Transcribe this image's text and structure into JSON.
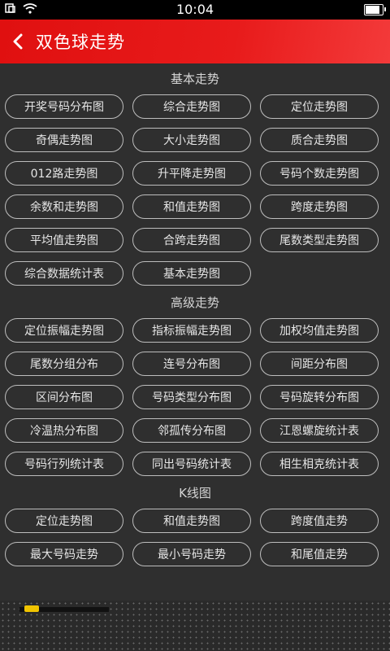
{
  "status": {
    "time": "10:04",
    "battery_level": 0.95
  },
  "header": {
    "title": "双色球走势",
    "back_icon": "chevron-left-icon"
  },
  "sections": [
    {
      "title": "基本走势",
      "items": [
        "开奖号码分布图",
        "综合走势图",
        "定位走势图",
        "奇偶走势图",
        "大小走势图",
        "质合走势图",
        "012路走势图",
        "升平降走势图",
        "号码个数走势图",
        "余数和走势图",
        "和值走势图",
        "跨度走势图",
        "平均值走势图",
        "合跨走势图",
        "尾数类型走势图",
        "综合数据统计表",
        "基本走势图"
      ]
    },
    {
      "title": "高级走势",
      "items": [
        "定位振幅走势图",
        "指标振幅走势图",
        "加权均值走势图",
        "尾数分组分布",
        "连号分布图",
        "间距分布图",
        "区间分布图",
        "号码类型分布图",
        "号码旋转分布图",
        "冷温热分布图",
        "邻孤传分布图",
        "江恩螺旋统计表",
        "号码行列统计表",
        "同出号码统计表",
        "相生相克统计表"
      ]
    },
    {
      "title": "K线图",
      "items": [
        "定位走势图",
        "和值走势图",
        "跨度值走势",
        "最大号码走势",
        "最小号码走势",
        "和尾值走势"
      ]
    }
  ]
}
